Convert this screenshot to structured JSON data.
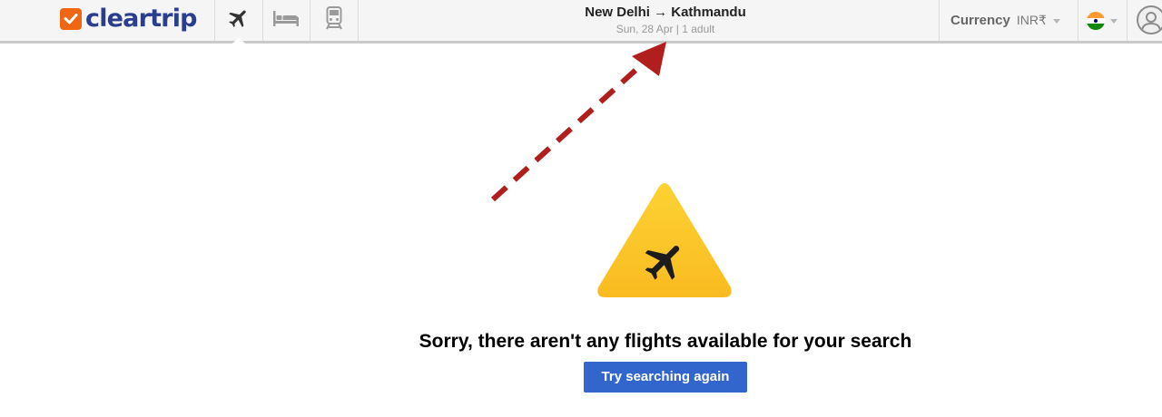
{
  "brand": {
    "name": "cleartrip",
    "logo_color": "#ef6614",
    "text_color": "#2b3d8f"
  },
  "nav": {
    "tabs": [
      {
        "name": "flights",
        "icon": "airplane-icon",
        "active": true
      },
      {
        "name": "hotels",
        "icon": "bed-icon",
        "active": false
      },
      {
        "name": "trains",
        "icon": "train-icon",
        "active": false
      }
    ]
  },
  "search_summary": {
    "route": "New Delhi → Kathmandu",
    "details": "Sun, 28 Apr | 1 adult"
  },
  "currency": {
    "label": "Currency",
    "value": "INR₹"
  },
  "country": {
    "flag_icon": "india-flag-icon"
  },
  "annotation": {
    "type": "dashed-arrow",
    "color": "#b01e1e",
    "points_to": "search-summary"
  },
  "empty_state": {
    "icon": "warning-airplane-icon",
    "message": "Sorry, there aren't any flights available for your search",
    "button_label": "Try searching again",
    "button_color": "#3366cc",
    "warning_color": "#fcc72b"
  }
}
